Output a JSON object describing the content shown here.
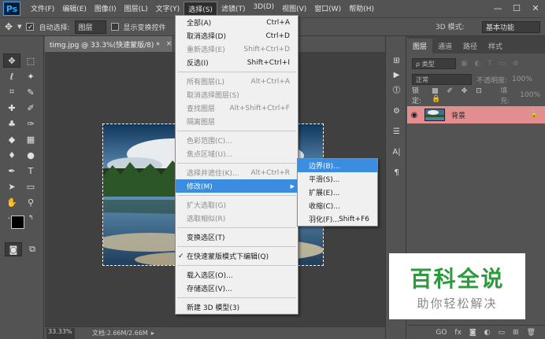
{
  "app": {
    "logo": "Ps"
  },
  "menubar": {
    "items": [
      "文件(F)",
      "编辑(E)",
      "图像(I)",
      "图层(L)",
      "文字(Y)",
      "选择(S)",
      "滤镜(T)",
      "3D(D)",
      "视图(V)",
      "窗口(W)",
      "帮助(H)"
    ],
    "active_index": 5
  },
  "window_controls": {
    "minimize": "—",
    "maximize": "☐",
    "close": "✕"
  },
  "options_bar": {
    "auto_select_label": "自动选择:",
    "auto_select_value": "图层",
    "show_transform_label": "显示变换控件",
    "mode_3d_label": "3D 模式:",
    "workspace": "基本功能"
  },
  "document": {
    "tab_title": "timg.jpg @ 33.3%(快速蒙版/8) *",
    "close": "×",
    "zoom": "33.33%",
    "doc_info": "文档:2.66M/2.66M"
  },
  "select_menu": {
    "items": [
      {
        "label": "全部(A)",
        "shortcut": "Ctrl+A",
        "state": "normal"
      },
      {
        "label": "取消选择(D)",
        "shortcut": "Ctrl+D",
        "state": "normal"
      },
      {
        "label": "重新选择(E)",
        "shortcut": "Shift+Ctrl+D",
        "state": "disabled"
      },
      {
        "label": "反选(I)",
        "shortcut": "Shift+Ctrl+I",
        "state": "normal"
      },
      {
        "sep": true
      },
      {
        "label": "所有图层(L)",
        "shortcut": "Alt+Ctrl+A",
        "state": "disabled"
      },
      {
        "label": "取消选择图层(S)",
        "shortcut": "",
        "state": "disabled"
      },
      {
        "label": "查找图层",
        "shortcut": "Alt+Shift+Ctrl+F",
        "state": "disabled"
      },
      {
        "label": "隔离图层",
        "shortcut": "",
        "state": "disabled"
      },
      {
        "sep": true
      },
      {
        "label": "色彩范围(C)...",
        "shortcut": "",
        "state": "disabled"
      },
      {
        "label": "焦点区域(U)...",
        "shortcut": "",
        "state": "disabled"
      },
      {
        "sep": true
      },
      {
        "label": "选择并遮住(K)...",
        "shortcut": "Alt+Ctrl+R",
        "state": "disabled"
      },
      {
        "label": "修改(M)",
        "shortcut": "",
        "state": "highlight",
        "submenu": true
      },
      {
        "sep": true
      },
      {
        "label": "扩大选取(G)",
        "shortcut": "",
        "state": "disabled"
      },
      {
        "label": "选取相似(R)",
        "shortcut": "",
        "state": "disabled"
      },
      {
        "sep": true
      },
      {
        "label": "变换选区(T)",
        "shortcut": "",
        "state": "normal"
      },
      {
        "sep": true
      },
      {
        "label": "在快速蒙版模式下编辑(Q)",
        "shortcut": "",
        "state": "checked"
      },
      {
        "sep": true
      },
      {
        "label": "载入选区(O)...",
        "shortcut": "",
        "state": "normal"
      },
      {
        "label": "存储选区(V)...",
        "shortcut": "",
        "state": "normal"
      },
      {
        "sep": true
      },
      {
        "label": "新建 3D 模型(3)",
        "shortcut": "",
        "state": "normal"
      }
    ]
  },
  "modify_submenu": {
    "items": [
      {
        "label": "边界(B)...",
        "shortcut": "",
        "state": "highlight"
      },
      {
        "label": "平滑(S)...",
        "shortcut": "",
        "state": "normal"
      },
      {
        "label": "扩展(E)...",
        "shortcut": "",
        "state": "normal"
      },
      {
        "label": "收缩(C)...",
        "shortcut": "",
        "state": "normal"
      },
      {
        "label": "羽化(F)...",
        "shortcut": "Shift+F6",
        "state": "normal"
      }
    ]
  },
  "layers_panel": {
    "tabs": [
      "图层",
      "通道",
      "路径",
      "样式"
    ],
    "active_tab": 0,
    "filter_label": "ρ 类型",
    "blend_mode": "正常",
    "opacity_label": "不透明度:",
    "opacity_value": "100%",
    "lock_label": "锁定:",
    "fill_label": "填充:",
    "fill_value": "100%",
    "layer_name": "背景",
    "footer_icons": [
      "GO",
      "fx"
    ]
  },
  "watermark": {
    "title": "百科全说",
    "subtitle": "助你轻松解决"
  },
  "colors": {
    "menu_highlight": "#3b8de0",
    "layer_selected": "#e38e8e",
    "watermark_green": "#2c9b3d"
  }
}
